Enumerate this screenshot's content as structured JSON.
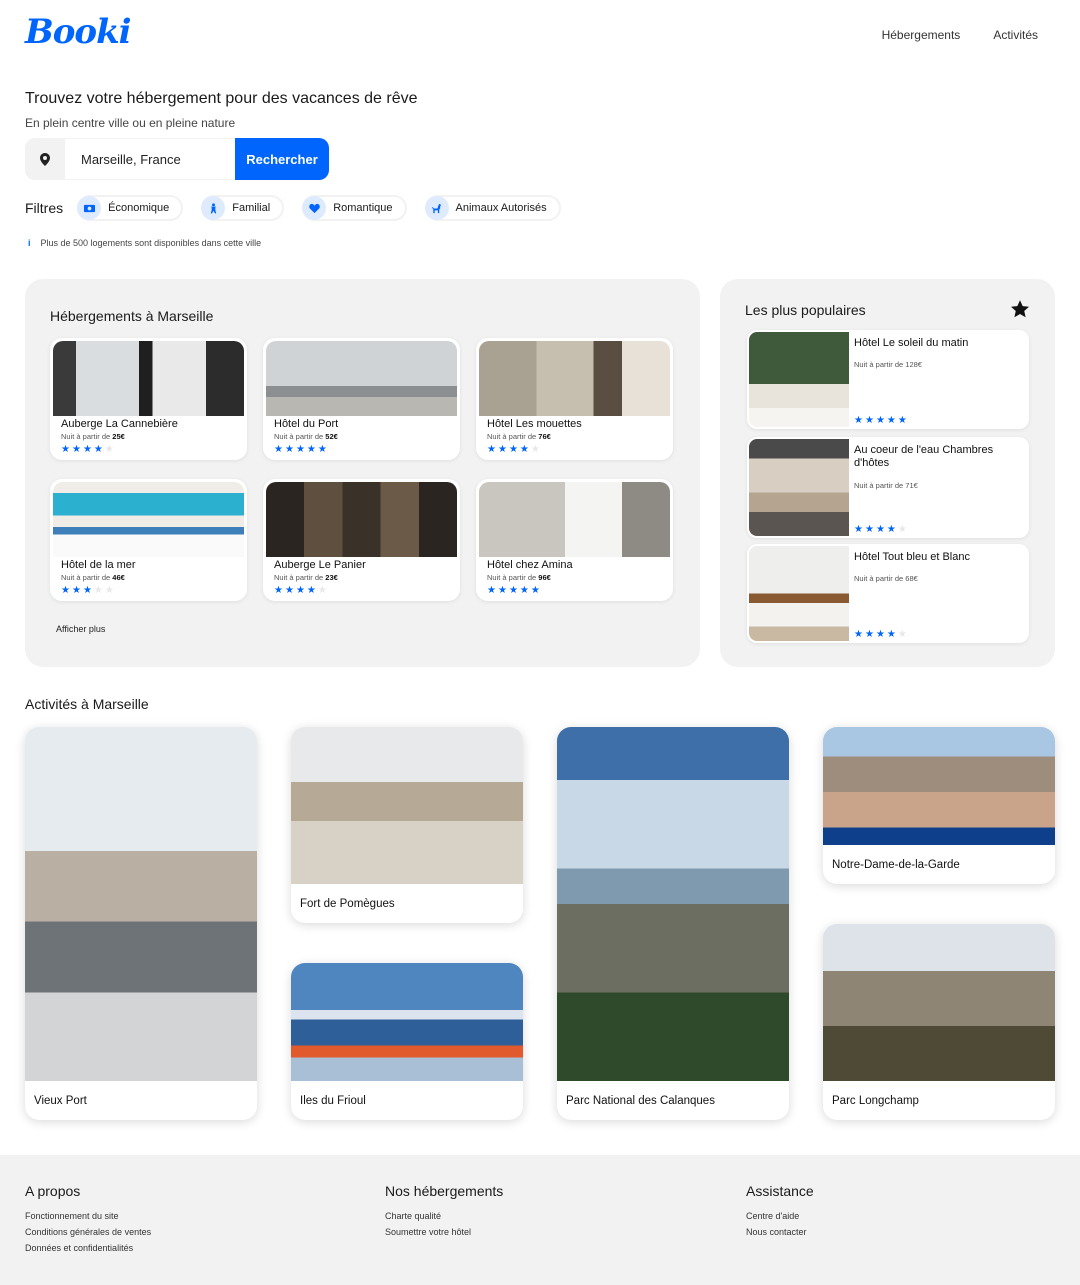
{
  "header": {
    "logo": "Booki",
    "nav": [
      "Hébergements",
      "Activités"
    ]
  },
  "hero": {
    "title": "Trouvez votre hébergement pour des vacances de rêve",
    "subtitle": "En plein centre ville ou en pleine nature",
    "search_value": "Marseille, France",
    "search_button": "Rechercher"
  },
  "filters": {
    "label": "Filtres",
    "items": [
      {
        "label": "Économique",
        "icon": "money-icon"
      },
      {
        "label": "Familial",
        "icon": "child-icon"
      },
      {
        "label": "Romantique",
        "icon": "heart-icon"
      },
      {
        "label": "Animaux Autorisés",
        "icon": "dog-icon"
      }
    ],
    "info": "Plus de 500 logements sont disponibles dans cette ville"
  },
  "lodging": {
    "title": "Hébergements à Marseille",
    "price_prefix": "Nuit à partir de",
    "items": [
      {
        "name": "Auberge La Cannebière",
        "price": "25€",
        "stars": 4
      },
      {
        "name": "Hôtel du Port",
        "price": "52€",
        "stars": 5
      },
      {
        "name": "Hôtel Les mouettes",
        "price": "76€",
        "stars": 4
      },
      {
        "name": "Hôtel de la mer",
        "price": "46€",
        "stars": 3
      },
      {
        "name": "Auberge Le Panier",
        "price": "23€",
        "stars": 4
      },
      {
        "name": "Hôtel chez Amina",
        "price": "96€",
        "stars": 5
      }
    ],
    "more": "Afficher plus"
  },
  "popular": {
    "title": "Les plus populaires",
    "price_prefix": "Nuit à partir de",
    "items": [
      {
        "name": "Hôtel Le soleil du matin",
        "price": "128€",
        "stars": 5
      },
      {
        "name": "Au coeur de l'eau Chambres d'hôtes",
        "price": "71€",
        "stars": 4
      },
      {
        "name": "Hôtel Tout bleu et Blanc",
        "price": "68€",
        "stars": 4
      }
    ]
  },
  "activities": {
    "title": "Activités à Marseille",
    "items": [
      "Vieux Port",
      "Fort de Pomègues",
      "Iles du Frioul",
      "Parc National des Calanques",
      "Notre-Dame-de-la-Garde",
      "Parc Longchamp"
    ]
  },
  "footer": {
    "columns": [
      {
        "title": "A propos",
        "links": [
          "Fonctionnement du site",
          "Conditions générales de ventes",
          "Données et confidentialités"
        ]
      },
      {
        "title": "Nos hébergements",
        "links": [
          "Charte qualité",
          "Soumettre votre hôtel"
        ]
      },
      {
        "title": "Assistance",
        "links": [
          "Centre d'aide",
          "Nous contacter"
        ]
      }
    ]
  },
  "colors": {
    "accent": "#0065fc",
    "panel": "#f2f2f2"
  }
}
